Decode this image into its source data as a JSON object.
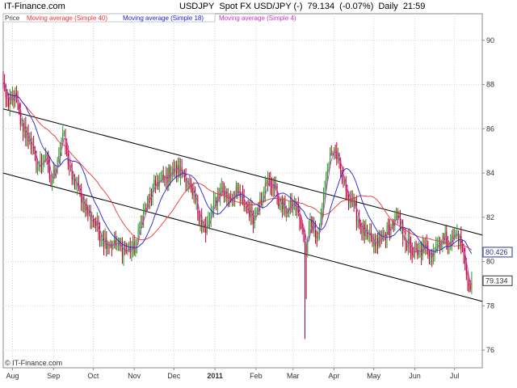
{
  "header": {
    "brand": "IT-Finance.com",
    "symbol": "USDJPY",
    "description": "Spot FX USD/JPY (-)",
    "last": "79.134",
    "change": "(-0.07%)",
    "period": "Daily",
    "time": "21:59"
  },
  "watermark": "© IT-Finance.com",
  "colors": {
    "up": "#2a9a2a",
    "down": "#b8002a",
    "ma40": "#ee3333",
    "ma18": "#2222cc",
    "ma4": "#cc33cc",
    "channel": "#000000",
    "grid": "#d4d4d4"
  },
  "chart_data": {
    "type": "candlestick",
    "y_axis_position": "right",
    "ylim": [
      75.2,
      91.2
    ],
    "y_ticks": [
      76,
      78,
      80,
      82,
      84,
      86,
      88,
      90
    ],
    "x_ticks": [
      {
        "label": "Aug",
        "day": 7,
        "bold": false
      },
      {
        "label": "Sep",
        "day": 38,
        "bold": false
      },
      {
        "label": "Oct",
        "day": 68,
        "bold": false
      },
      {
        "label": "Nov",
        "day": 99,
        "bold": false
      },
      {
        "label": "Dec",
        "day": 129,
        "bold": false
      },
      {
        "label": "2011",
        "day": 160,
        "bold": true
      },
      {
        "label": "Feb",
        "day": 191,
        "bold": false
      },
      {
        "label": "Mar",
        "day": 219,
        "bold": false
      },
      {
        "label": "Apr",
        "day": 250,
        "bold": false
      },
      {
        "label": "May",
        "day": 280,
        "bold": false
      },
      {
        "label": "Jun",
        "day": 311,
        "bold": false
      },
      {
        "label": "Jul",
        "day": 341,
        "bold": false
      }
    ],
    "day_range": [
      0,
      362
    ],
    "close_anchors": [
      [
        0,
        88.1
      ],
      [
        4,
        87.0
      ],
      [
        9,
        87.6
      ],
      [
        13,
        86.2
      ],
      [
        20,
        85.5
      ],
      [
        26,
        84.2
      ],
      [
        32,
        84.8
      ],
      [
        36,
        83.5
      ],
      [
        41,
        84.6
      ],
      [
        45,
        85.8
      ],
      [
        52,
        83.7
      ],
      [
        58,
        83.1
      ],
      [
        63,
        82.3
      ],
      [
        69,
        81.8
      ],
      [
        75,
        81.0
      ],
      [
        83,
        80.8
      ],
      [
        92,
        80.5
      ],
      [
        100,
        80.6
      ],
      [
        104,
        81.8
      ],
      [
        110,
        82.8
      ],
      [
        116,
        83.6
      ],
      [
        122,
        83.7
      ],
      [
        128,
        84.2
      ],
      [
        136,
        84.0
      ],
      [
        143,
        83.0
      ],
      [
        149,
        82.0
      ],
      [
        153,
        81.3
      ],
      [
        158,
        82.3
      ],
      [
        164,
        83.3
      ],
      [
        170,
        82.9
      ],
      [
        177,
        83.1
      ],
      [
        184,
        82.4
      ],
      [
        190,
        82.0
      ],
      [
        194,
        82.8
      ],
      [
        199,
        83.5
      ],
      [
        204,
        83.5
      ],
      [
        209,
        82.6
      ],
      [
        214,
        82.3
      ],
      [
        219,
        82.6
      ],
      [
        223,
        82.2
      ],
      [
        226,
        81.5
      ],
      [
        229,
        80.4
      ],
      [
        232,
        81.9
      ],
      [
        238,
        81.2
      ],
      [
        243,
        83.3
      ],
      [
        247,
        84.9
      ],
      [
        251,
        85.0
      ],
      [
        255,
        84.0
      ],
      [
        259,
        83.2
      ],
      [
        265,
        82.5
      ],
      [
        270,
        81.6
      ],
      [
        275,
        81.1
      ],
      [
        281,
        80.7
      ],
      [
        287,
        81.1
      ],
      [
        293,
        81.6
      ],
      [
        298,
        82.0
      ],
      [
        303,
        81.1
      ],
      [
        308,
        80.5
      ],
      [
        313,
        80.3
      ],
      [
        318,
        80.6
      ],
      [
        323,
        80.4
      ],
      [
        328,
        80.8
      ],
      [
        333,
        81.1
      ],
      [
        338,
        80.9
      ],
      [
        343,
        81.3
      ],
      [
        347,
        80.6
      ],
      [
        350,
        79.4
      ],
      [
        352,
        78.9
      ],
      [
        354,
        79.13
      ]
    ],
    "spikes": [
      {
        "day": 228,
        "low": 76.5
      },
      {
        "day": 229,
        "low": 78.3
      }
    ],
    "last_price": 79.134,
    "ma40_value": 80.426,
    "channel_lines": [
      {
        "from": {
          "day": 0,
          "price": 86.9
        },
        "to": {
          "day": 362,
          "price": 81.2
        }
      },
      {
        "from": {
          "day": 0,
          "price": 84.0
        },
        "to": {
          "day": 362,
          "price": 78.2
        }
      }
    ],
    "legend": {
      "price_label": "Price",
      "items": [
        {
          "label": "Moving average (Simple 40)",
          "color": "#ee3333",
          "period": 40
        },
        {
          "label": "Moving average (Simple 18)",
          "color": "#2222cc",
          "period": 18
        },
        {
          "label": "Moving average (Simple 4)",
          "color": "#cc33cc",
          "period": 4
        }
      ]
    }
  }
}
